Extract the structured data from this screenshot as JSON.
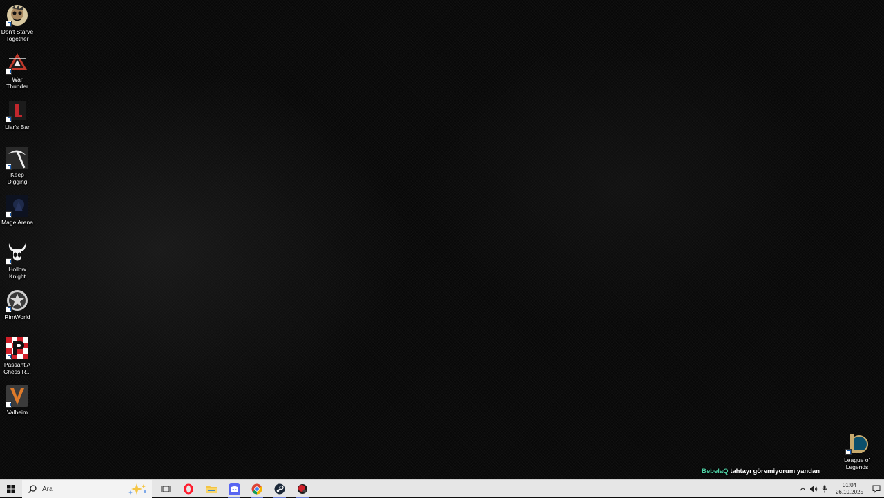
{
  "desktop": {
    "icons": [
      {
        "label": "Don't Starve Together",
        "icon": "dont-starve-icon"
      },
      {
        "label": "War Thunder",
        "icon": "war-thunder-icon"
      },
      {
        "label": "Liar's Bar",
        "icon": "liars-bar-icon"
      },
      {
        "label": "Keep Digging",
        "icon": "pickaxe-icon"
      },
      {
        "label": "Mage Arena",
        "icon": "mage-arena-icon"
      },
      {
        "label": "Hollow Knight",
        "icon": "hollow-knight-icon"
      },
      {
        "label": "RimWorld",
        "icon": "rimworld-icon"
      },
      {
        "label": "Passant A Chess R...",
        "icon": "chess-icon"
      },
      {
        "label": "Valheim",
        "icon": "valheim-icon"
      }
    ],
    "right_icon": {
      "label": "League of Legends",
      "icon": "league-of-legends-icon"
    }
  },
  "chat_overlay": {
    "user": "BebelaQ",
    "message": "tahtayı göremiyorum yandan"
  },
  "taskbar": {
    "search_placeholder": "Ara",
    "apps": [
      {
        "name": "opera",
        "icon": "opera-icon"
      },
      {
        "name": "file-explorer",
        "icon": "folder-icon"
      },
      {
        "name": "discord",
        "icon": "discord-icon"
      },
      {
        "name": "chrome",
        "icon": "chrome-icon"
      },
      {
        "name": "steam",
        "icon": "steam-icon"
      },
      {
        "name": "app",
        "icon": "red-app-icon"
      }
    ],
    "clock": {
      "time": "01:04",
      "date": "26.10.2025"
    }
  },
  "colors": {
    "taskbar": "#e6e6e6",
    "chat_user": "#4fd1a5"
  }
}
